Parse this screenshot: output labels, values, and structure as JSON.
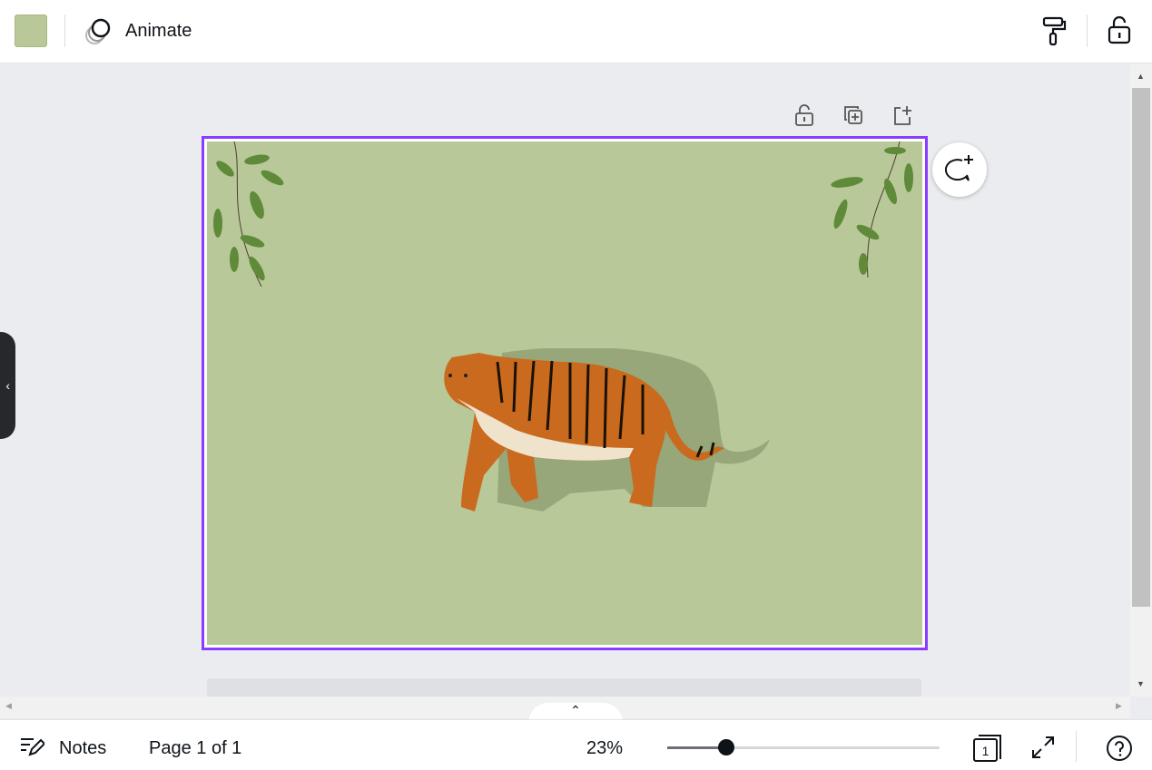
{
  "toolbar": {
    "color": "#b8c898",
    "animate_label": "Animate"
  },
  "canvas": {
    "background": "#b8c898",
    "selection_color": "#8b3dff",
    "collapse_glyph": "‹"
  },
  "footer": {
    "notes_label": "Notes",
    "page_indicator": "Page 1 of 1",
    "zoom": "23%",
    "zoom_value_percent": 23,
    "pages_count": "1",
    "expand_glyph": "⌃"
  }
}
